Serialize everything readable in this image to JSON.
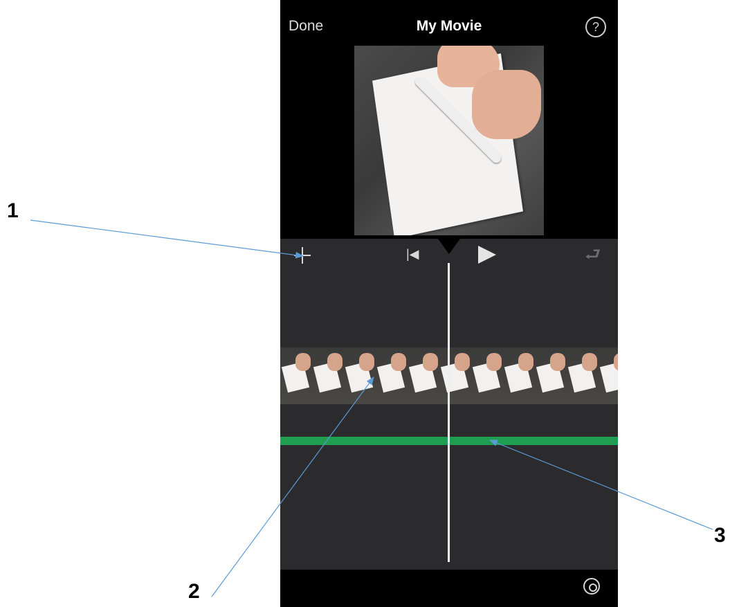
{
  "header": {
    "done_label": "Done",
    "title": "My Movie",
    "help_label": "?"
  },
  "controls": {
    "add_icon": "plus-icon",
    "skip_back_icon": "skip-to-start-icon",
    "play_icon": "play-icon",
    "undo_icon": "undo-icon"
  },
  "bottom": {
    "settings_icon": "gear-icon"
  },
  "timeline": {
    "clip_frames": 11,
    "audio_color": "#1f9e51"
  },
  "callouts": [
    "1",
    "2",
    "3"
  ]
}
